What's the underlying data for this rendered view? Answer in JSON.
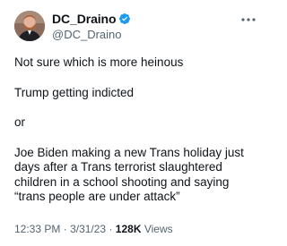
{
  "tweet": {
    "author": {
      "display_name": "DC_Draino",
      "handle": "@DC_Draino",
      "verified": true
    },
    "paragraphs": [
      "Not sure which is more heinous",
      "Trump getting indicted",
      "or",
      "Joe Biden making a new Trans holiday just days after a Trans terrorist slaughtered children in a school shooting and saying “trans people are under attack”"
    ],
    "meta": {
      "time": "12:33 PM",
      "separator": "·",
      "date": "3/31/23",
      "views_count": "128K",
      "views_label": "Views"
    }
  },
  "icons": {
    "verified": "verified-badge-icon",
    "more": "more-options-icon"
  },
  "colors": {
    "text_primary": "#0f1419",
    "text_secondary": "#536471",
    "verified_blue": "#1d9bf0",
    "background": "#ffffff"
  }
}
